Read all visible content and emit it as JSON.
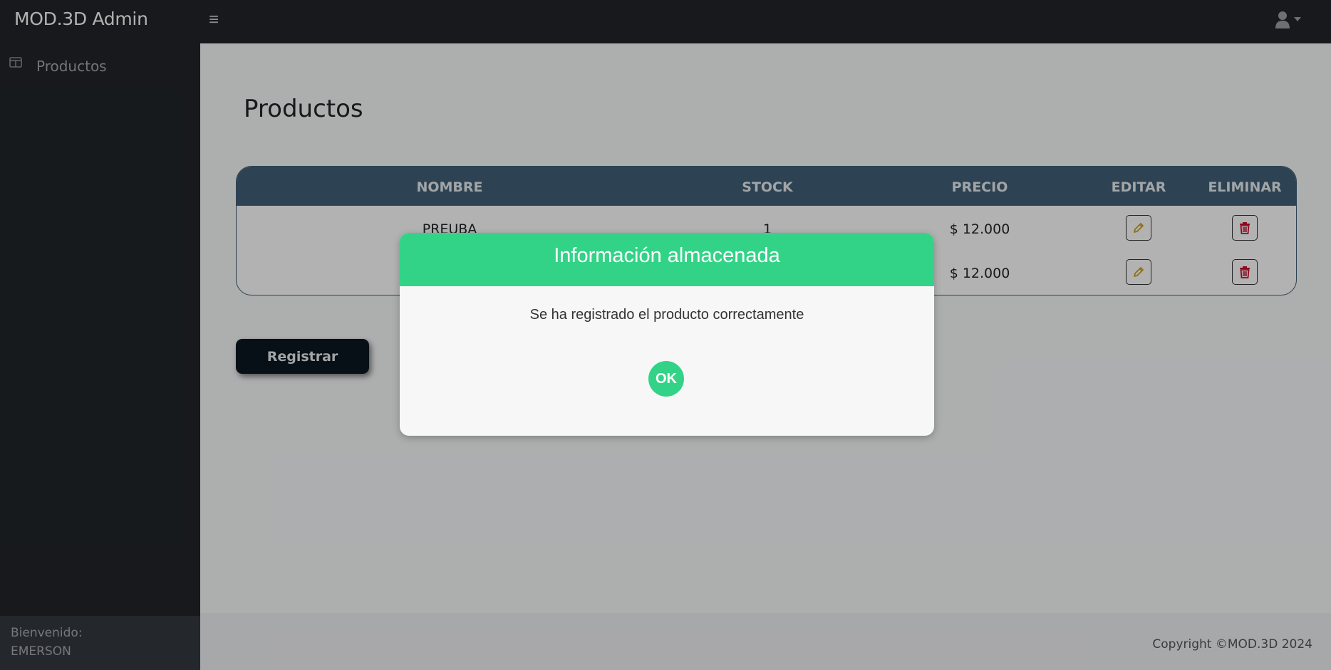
{
  "app": {
    "brand": "MOD.3D Admin"
  },
  "sidebar": {
    "items": [
      {
        "label": "Productos",
        "icon": "table-columns-icon"
      }
    ],
    "footer": {
      "greeting": "Bienvenido:",
      "username": "EMERSON"
    }
  },
  "main": {
    "title": "Productos",
    "table": {
      "headers": [
        "NOMBRE",
        "STOCK",
        "PRECIO",
        "EDITAR",
        "ELIMINAR"
      ],
      "rows": [
        {
          "nombre": "PREUBA",
          "stock": "1",
          "precio": "$ 12.000"
        },
        {
          "nombre": "",
          "stock": "",
          "precio": "$ 12.000"
        }
      ]
    },
    "register_label": "Registrar"
  },
  "footer": {
    "copyright": "Copyright ©MOD.3D 2024"
  },
  "modal": {
    "title": "Información almacenada",
    "message": "Se ha registrado el producto correctamente",
    "ok_label": "OK"
  },
  "colors": {
    "navbar": "#212529",
    "table_header": "#416178",
    "success": "#33d387",
    "edit_icon": "#c9a227",
    "delete_icon": "#c8102e"
  }
}
